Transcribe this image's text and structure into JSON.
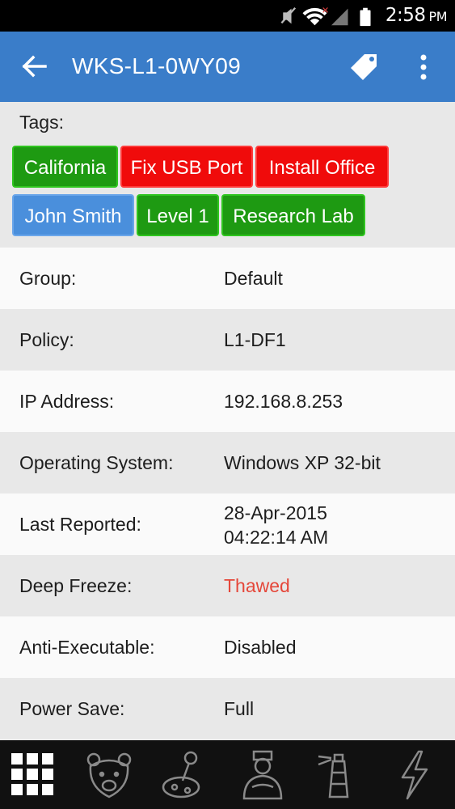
{
  "status_bar": {
    "time": "2:58",
    "ampm": "PM",
    "icons": [
      "mute-icon",
      "wifi-icon",
      "signal-icon",
      "battery-icon"
    ]
  },
  "app_bar": {
    "title": "WKS-L1-0WY09",
    "actions": [
      "back-arrow-icon",
      "tag-icon",
      "more-vertical-icon"
    ]
  },
  "tags": {
    "label": "Tags:",
    "items": [
      {
        "text": "California",
        "color": "#1e9a12"
      },
      {
        "text": "Fix USB Port",
        "color": "#f00b0b"
      },
      {
        "text": "Install Office",
        "color": "#f00b0b"
      },
      {
        "text": "John Smith",
        "color": "#4a8fdc"
      },
      {
        "text": "Level 1",
        "color": "#1e9a12"
      },
      {
        "text": "Research Lab",
        "color": "#1e9a12"
      }
    ]
  },
  "details": [
    {
      "label": "Group:",
      "value": "Default"
    },
    {
      "label": "Policy:",
      "value": "L1-DF1"
    },
    {
      "label": "IP Address:",
      "value": "192.168.8.253"
    },
    {
      "label": "Operating System:",
      "value": "Windows XP 32-bit"
    },
    {
      "label": "Last Reported:",
      "value_line1": "28-Apr-2015",
      "value_line2": "04:22:14 AM"
    },
    {
      "label": "Deep Freeze:",
      "value": "Thawed",
      "value_color": "#e5473a"
    },
    {
      "label": "Anti-Executable:",
      "value": "Disabled"
    },
    {
      "label": "Power Save:",
      "value": "Full"
    }
  ],
  "bottom_nav": [
    "grid-icon",
    "bear-icon",
    "joystick-icon",
    "butler-icon",
    "lighthouse-icon",
    "lightning-icon"
  ]
}
